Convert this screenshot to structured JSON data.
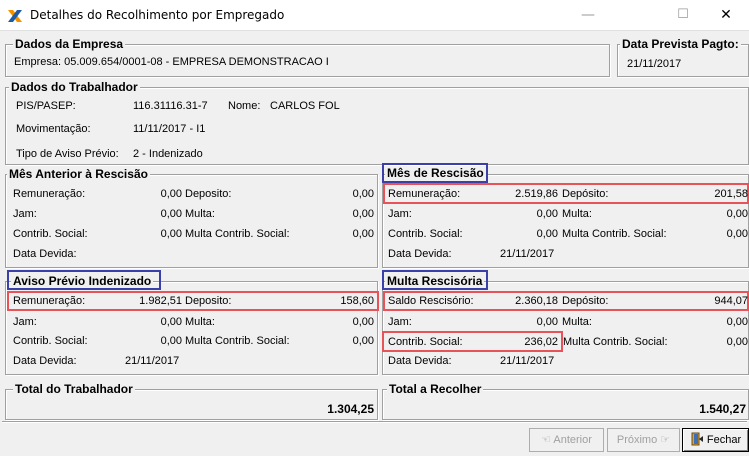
{
  "window": {
    "title": "Detalhes do Recolhimento por Empregado",
    "minimize": "—",
    "maximize": "☐",
    "close": "✕"
  },
  "empresa": {
    "title": "Dados da Empresa",
    "text": "Empresa: 05.009.654/0001-08 - EMPRESA DEMONSTRACAO I"
  },
  "data_prevista": {
    "title": "Data Prevista Pagto:",
    "value": "21/11/2017"
  },
  "trabalhador": {
    "title": "Dados do Trabalhador",
    "pis_label": "PIS/PASEP:",
    "pis_value": "116.31116.31-7",
    "nome_label": "Nome:",
    "nome_value": "CARLOS FOL",
    "mov_label": "Movimentação:",
    "mov_value": "11/11/2017 - I1",
    "aviso_label": "Tipo de Aviso Prévio:",
    "aviso_value": "2 - Indenizado"
  },
  "labels": {
    "remuneracao": "Remuneração:",
    "deposito": "Deposito:",
    "deposito_acc": "Depósito:",
    "jam": "Jam:",
    "multa": "Multa:",
    "contrib": "Contrib. Social:",
    "multa_contrib": "Multa Contrib. Social:",
    "data_devida": "Data Devida:",
    "saldo_rescisorio": "Saldo Rescisório:"
  },
  "mes_anterior": {
    "title": "Mês Anterior à Rescisão",
    "remuneracao": "0,00",
    "deposito": "0,00",
    "jam": "0,00",
    "multa": "0,00",
    "contrib": "0,00",
    "multa_contrib": "0,00",
    "data_devida": ""
  },
  "mes_rescisao": {
    "title": "Mês de Rescisão",
    "remuneracao": "2.519,86",
    "deposito": "201,58",
    "jam": "0,00",
    "multa": "0,00",
    "contrib": "0,00",
    "multa_contrib": "0,00",
    "data_devida": "21/11/2017"
  },
  "aviso_previo": {
    "title": "Aviso Prévio Indenizado",
    "remuneracao": "1.982,51",
    "deposito": "158,60",
    "jam": "0,00",
    "multa": "0,00",
    "contrib": "0,00",
    "multa_contrib": "0,00",
    "data_devida": "21/11/2017"
  },
  "multa_rescisoria": {
    "title": "Multa Rescisória",
    "saldo": "2.360,18",
    "deposito": "944,07",
    "jam": "0,00",
    "multa": "0,00",
    "contrib": "236,02",
    "multa_contrib": "0,00",
    "data_devida": "21/11/2017"
  },
  "totais": {
    "trabalhador_title": "Total do Trabalhador",
    "trabalhador_value": "1.304,25",
    "recolher_title": "Total a Recolher",
    "recolher_value": "1.540,27"
  },
  "buttons": {
    "anterior": "Anterior",
    "proximo": "Próximo",
    "fechar": "Fechar"
  }
}
